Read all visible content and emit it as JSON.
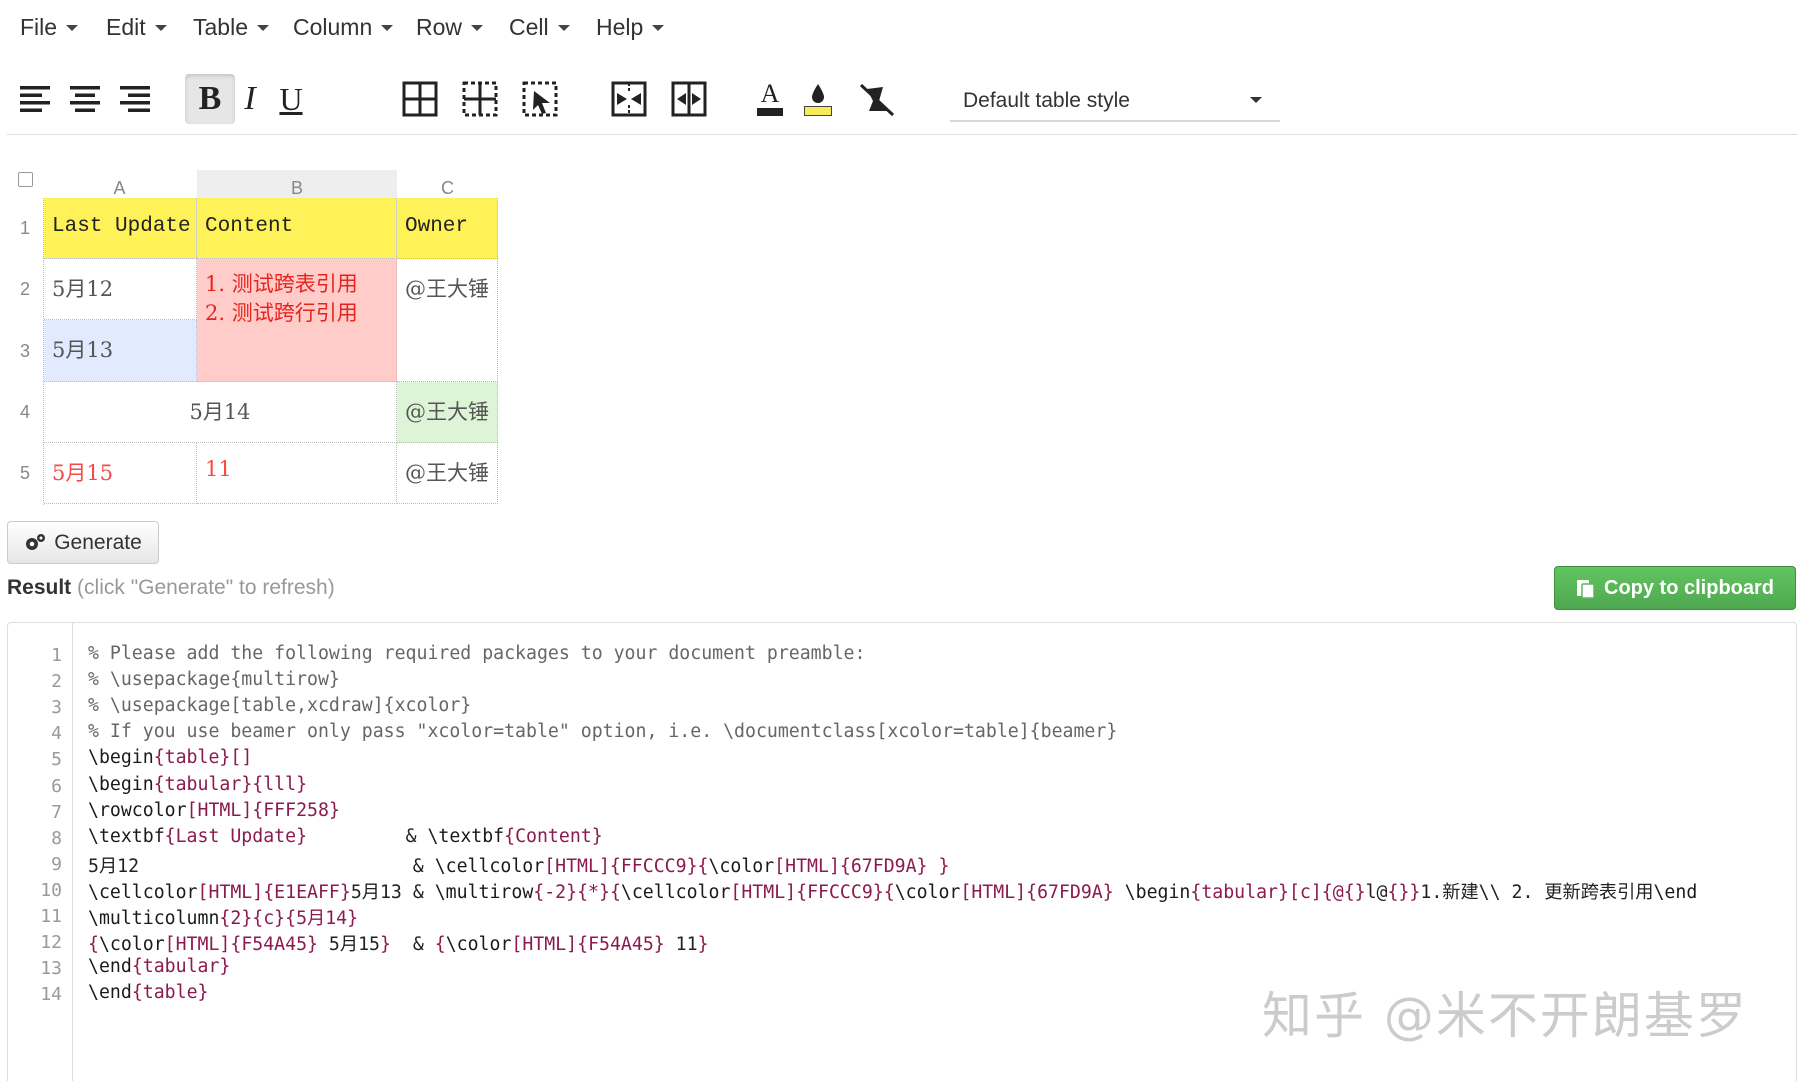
{
  "menu": [
    "File",
    "Edit",
    "Table",
    "Column",
    "Row",
    "Cell",
    "Help"
  ],
  "toolbar": {
    "buttons": [
      "align-left",
      "align-center",
      "align-right",
      "bold",
      "italic",
      "underline",
      "borders-all",
      "borders-inner",
      "borders-remove",
      "merge-cells",
      "split-cells",
      "text-color",
      "background-color",
      "clear-formatting"
    ],
    "bold_glyph": "B",
    "italic_glyph": "I",
    "underline_glyph": "U",
    "text_color_glyph": "A",
    "table_style": "Default table style"
  },
  "sheet": {
    "columns": [
      "A",
      "B",
      "C"
    ],
    "rows": [
      "1",
      "2",
      "3",
      "4",
      "5"
    ],
    "header": {
      "a": "Last Update",
      "b": "Content",
      "c": "Owner"
    },
    "r2": {
      "a": "5月12",
      "b_line1": "1.  测试跨表引用",
      "b_line2": "2.  测试跨行引用",
      "c": "@王大锤"
    },
    "r3": {
      "a": "5月13"
    },
    "r4": {
      "ab": "5月14",
      "c": "@王大锤"
    },
    "r5": {
      "a": "5月15",
      "b": "11",
      "c": "@王大锤"
    },
    "colors": {
      "header_bg": "#FFF258",
      "content_bg": "#FFCCC9",
      "content_text": "#E8231E",
      "r3_bg": "#E1EAFF",
      "r4c_bg": "#DDF5D6",
      "r5_text": "#F54A45"
    }
  },
  "result": {
    "generate_label": "Generate",
    "title": "Result",
    "hint": "(click \"Generate\" to refresh)",
    "copy_label": "Copy to clipboard",
    "line_numbers": [
      "1",
      "2",
      "3",
      "4",
      "5",
      "6",
      "7",
      "8",
      "9",
      "10",
      "11",
      "12",
      "13",
      "14"
    ],
    "code": [
      "% Please add the following required packages to your document preamble:",
      "% \\usepackage{multirow}",
      "% \\usepackage[table,xcdraw]{xcolor}",
      "% If you use beamer only pass \"xcolor=table\" option, i.e. \\documentclass[xcolor=table]{beamer}",
      "\\begin{table}[]",
      "\\begin{tabular}{lll}",
      "\\rowcolor[HTML]{FFF258}",
      "\\textbf{Last Update}         & \\textbf{Content}",
      "5月12                         & \\cellcolor[HTML]{FFCCC9}{\\color[HTML]{67FD9A} }",
      "\\cellcolor[HTML]{E1EAFF}5月13 & \\multirow{-2}{*}{\\cellcolor[HTML]{FFCCC9}{\\color[HTML]{67FD9A} \\begin{tabular}[c]{@{}l@{}}1.新建\\\\ 2. 更新跨表引用\\end",
      "\\multicolumn{2}{c}{5月14}",
      "{\\color[HTML]{F54A45} 5月15}  & {\\color[HTML]{F54A45} 11}",
      "\\end{tabular}",
      "\\end{table}"
    ]
  },
  "watermark": "知乎 @米不开朗基罗"
}
